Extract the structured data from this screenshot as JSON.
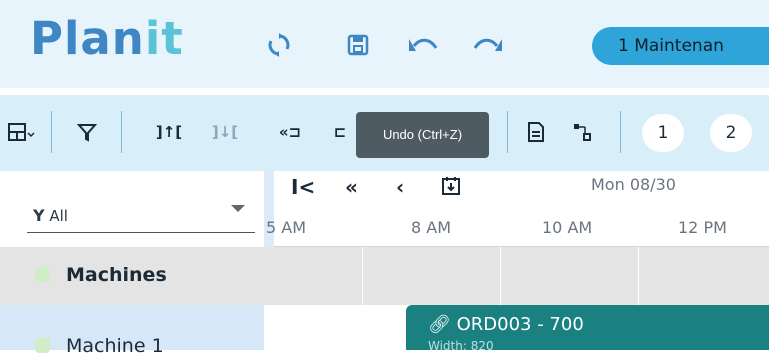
{
  "app": {
    "logo_plan": "Plan",
    "logo_it": "it"
  },
  "header": {
    "icons": [
      "sync-icon",
      "save-icon",
      "undo-icon",
      "redo-icon"
    ],
    "maintenance_pill": "1 Maintenan"
  },
  "toolbar": {
    "icons": [
      "table-dropdown-icon",
      "filter-icon",
      "sort-up-icon",
      "sort-down-icon",
      "collapse-icon",
      "expand-icon",
      "document-icon",
      "connect-icon"
    ],
    "round_buttons": [
      "1",
      "2"
    ],
    "tooltip": "Undo (Ctrl+Z)"
  },
  "filter": {
    "value": "All"
  },
  "timeline": {
    "nav_icons": [
      "first-icon",
      "prev-fast-icon",
      "prev-icon",
      "today-icon"
    ],
    "date": "Mon 08/30",
    "times": [
      "5 AM",
      "8 AM",
      "10 AM",
      "12 PM"
    ]
  },
  "rows": [
    {
      "label": "Machines",
      "group": true
    },
    {
      "label": "Machine 1",
      "group": false
    }
  ],
  "order": {
    "title": "ORD003 - 700",
    "subtitle": "Width: 820"
  },
  "colors": {
    "accent": "#2ea4d8",
    "order": "#1a8080",
    "logo": "#3f86c4"
  }
}
